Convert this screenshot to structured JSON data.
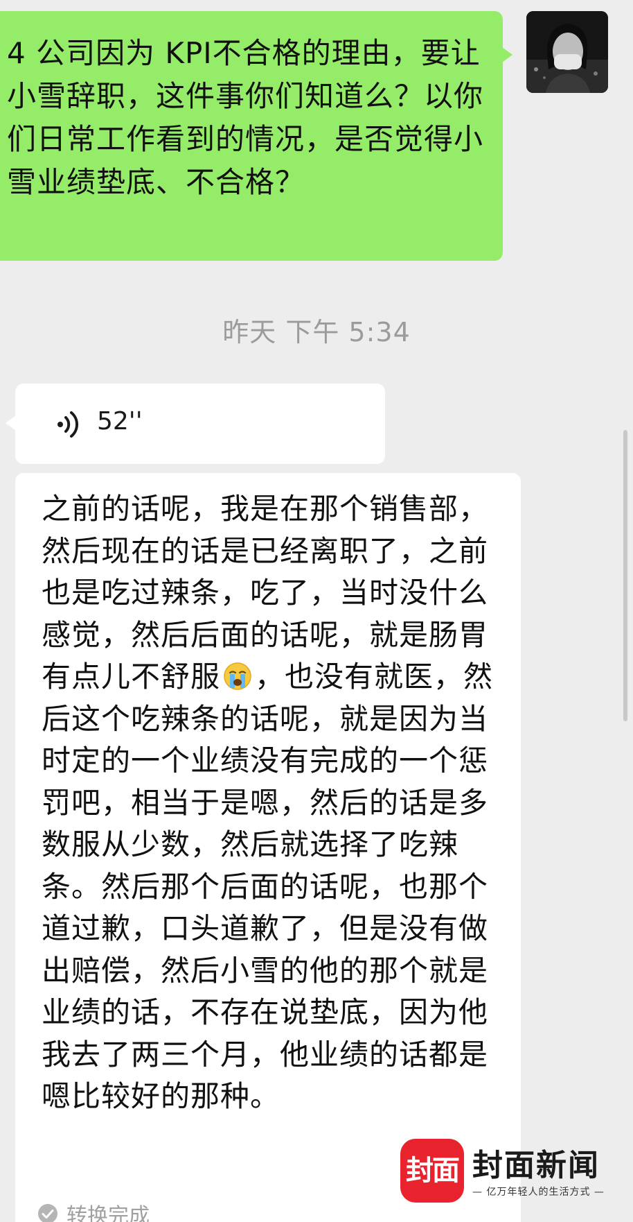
{
  "chat": {
    "sent_message": {
      "text": "4 公司因为 KPI不合格的理由，要让小雪辞职，这件事你们知道么？以你们日常工作看到的情况，是否觉得小雪业绩垫底、不合格？",
      "bubble_color": "#95ec69"
    },
    "timestamp": "昨天 下午 5:34",
    "voice_message": {
      "duration": "52''",
      "icon": "voice-wave-icon"
    },
    "transcript": {
      "text_part1": "之前的话呢，我是在那个销售部，然后现在的话是已经离职了，之前也是吃过辣条，吃了，当时没什么感觉，然后后面的话呢，就是肠胃有点儿不舒服",
      "emoji": "crying-face-icon",
      "text_part2": "，也没有就医，然后这个吃辣条的话呢，就是因为当时定的一个业绩没有完成的一个惩罚吧，相当于是嗯，然后的话是多数服从少数，然后就选择了吃辣条。然后那个后面的话呢，也那个道过歉，口头道歉了，但是没有做出赔偿，然后小雪的他的那个就是业绩的话，不存在说垫底，因为他我去了两三个月，他业绩的话都是嗯比较好的那种。",
      "status": "转换完成",
      "status_icon": "check-circle-icon"
    }
  },
  "watermark": {
    "badge": "封面",
    "name": "封面新闻",
    "slogan": "— 亿万年轻人的生活方式 —",
    "brand_color": "#e8232e"
  }
}
